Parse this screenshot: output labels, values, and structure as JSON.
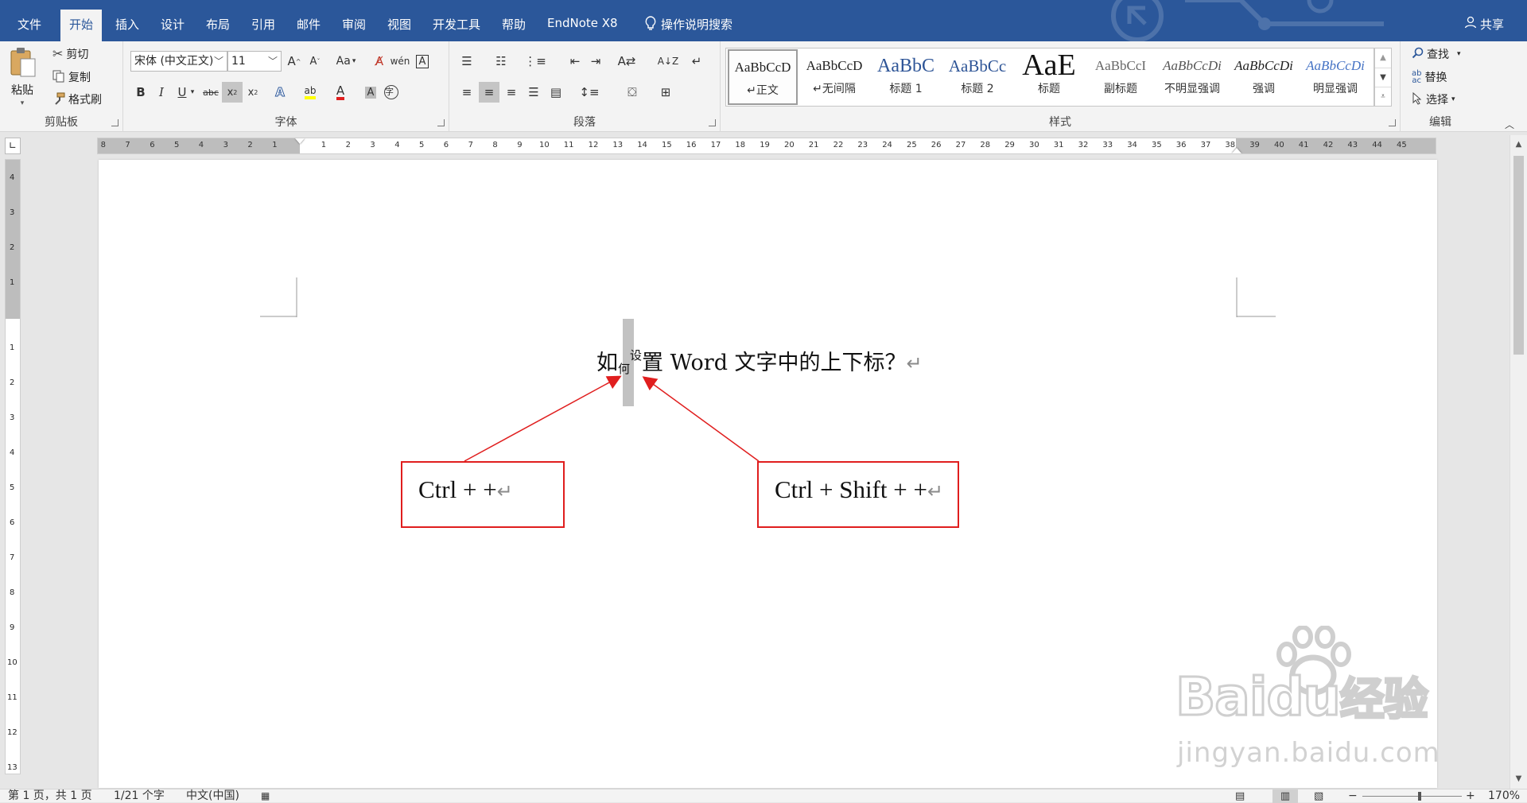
{
  "tabs": [
    "文件",
    "开始",
    "插入",
    "设计",
    "布局",
    "引用",
    "邮件",
    "审阅",
    "视图",
    "开发工具",
    "帮助",
    "EndNote X8"
  ],
  "tell_me": "操作说明搜索",
  "share": "共享",
  "clipboard": {
    "paste": "粘贴",
    "cut": "剪切",
    "copy": "复制",
    "format_painter": "格式刷",
    "label": "剪贴板"
  },
  "font": {
    "name": "宋体 (中文正文)",
    "size": "11",
    "label": "字体",
    "case_btn": "Aa"
  },
  "paragraph": {
    "label": "段落"
  },
  "styles": {
    "label": "样式",
    "items": [
      {
        "preview": "AaBbCcD",
        "name": "↵正文"
      },
      {
        "preview": "AaBbCcD",
        "name": "↵无间隔"
      },
      {
        "preview": "AaBbC",
        "name": "标题 1"
      },
      {
        "preview": "AaBbCc",
        "name": "标题 2"
      },
      {
        "preview": "AaE",
        "name": "标题"
      },
      {
        "preview": "AaBbCcI",
        "name": "副标题"
      },
      {
        "preview": "AaBbCcDi",
        "name": "不明显强调"
      },
      {
        "preview": "AaBbCcDi",
        "name": "强调"
      },
      {
        "preview": "AaBbCcDi",
        "name": "明显强调"
      }
    ]
  },
  "editing": {
    "find": "查找",
    "replace": "替换",
    "select": "选择",
    "label": "编辑"
  },
  "ruler": {
    "h_left": [
      "8",
      "7",
      "6",
      "5",
      "4",
      "3",
      "2",
      "1"
    ],
    "h_right": [
      "1",
      "2",
      "3",
      "4",
      "5",
      "6",
      "7",
      "8",
      "9",
      "10",
      "11",
      "12",
      "13",
      "14",
      "15",
      "16",
      "17",
      "18",
      "19",
      "20",
      "21",
      "22",
      "23",
      "24",
      "25",
      "26",
      "27",
      "28",
      "29",
      "30",
      "31",
      "32",
      "33",
      "34",
      "35",
      "36",
      "37",
      "38",
      "39",
      "40",
      "41",
      "42",
      "43",
      "44",
      "45"
    ],
    "v_top": [
      "4",
      "3",
      "2",
      "1"
    ],
    "v_bottom": [
      "1",
      "2",
      "3",
      "4",
      "5",
      "6",
      "7",
      "8",
      "9",
      "10",
      "11",
      "12",
      "13"
    ]
  },
  "document": {
    "before": "如",
    "subscript": "何",
    "superscript": "设",
    "after": "置 Word 文字中的上下标？",
    "para_mark": "↵",
    "callout_subscript": "Ctrl + +",
    "callout_superscript": "Ctrl + Shift + +"
  },
  "watermark": {
    "brand": "Baidu",
    "cn": "经验",
    "url": "jingyan.baidu.com"
  },
  "status": {
    "page": "第 1 页，共 1 页",
    "words": "1/21 个字",
    "language": "中文(中国)",
    "zoom": "170%"
  },
  "colors": {
    "accent": "#2b579a",
    "arrow": "#e01e1e",
    "highlight": "#ffff00",
    "font_color": "#e01e1e"
  }
}
